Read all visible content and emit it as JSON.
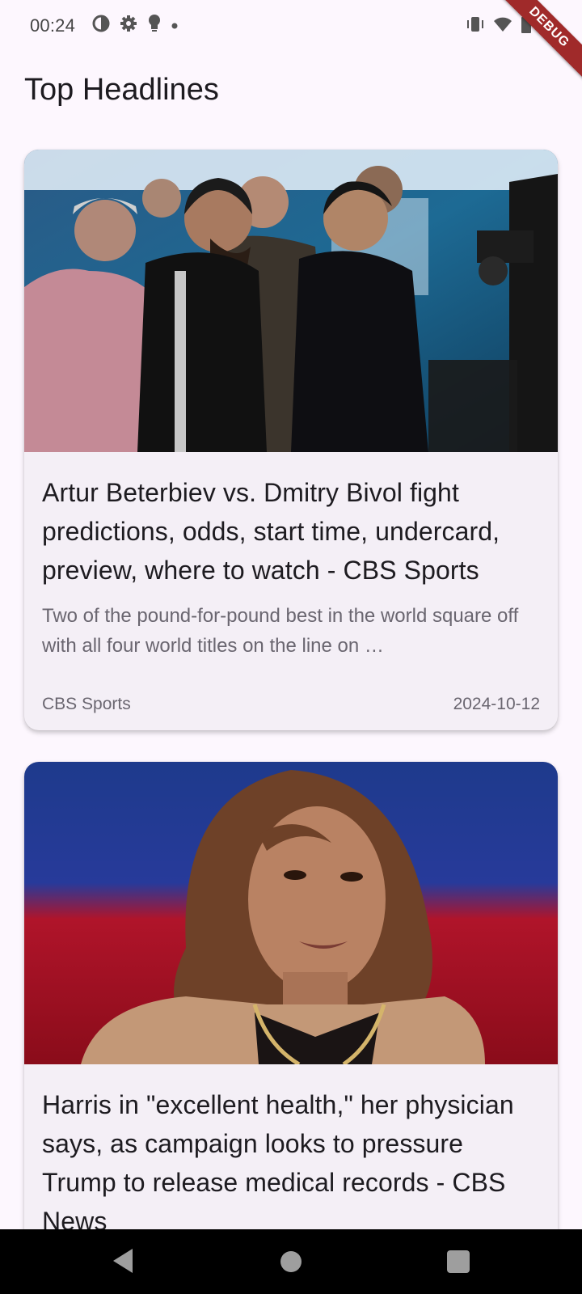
{
  "status_bar": {
    "time": "00:24",
    "left_icons": [
      "data-saver-icon",
      "settings-icon",
      "lightbulb-icon",
      "dot-icon"
    ],
    "right_icons": [
      "vibrate-icon",
      "wifi-icon",
      "battery-icon"
    ]
  },
  "debug_banner": "DEBUG",
  "page": {
    "title": "Top Headlines"
  },
  "articles": [
    {
      "image_desc": "boxers-faceoff-photo",
      "title": "Artur Beterbiev vs. Dmitry Bivol fight predictions, odds, start time, undercard, preview, where to watch - CBS Sports",
      "description": "Two of the pound-for-pound best in the world square off with all four world titles on the line on …",
      "source": "CBS Sports",
      "date": "2024-10-12"
    },
    {
      "image_desc": "portrait-photo",
      "title": "Harris in \"excellent health,\" her physician says, as campaign looks to pressure Trump to release medical records - CBS News"
    }
  ],
  "colors": {
    "background": "#fdf7fe",
    "card": "#f4eff6",
    "debug": "#a02a2a"
  }
}
